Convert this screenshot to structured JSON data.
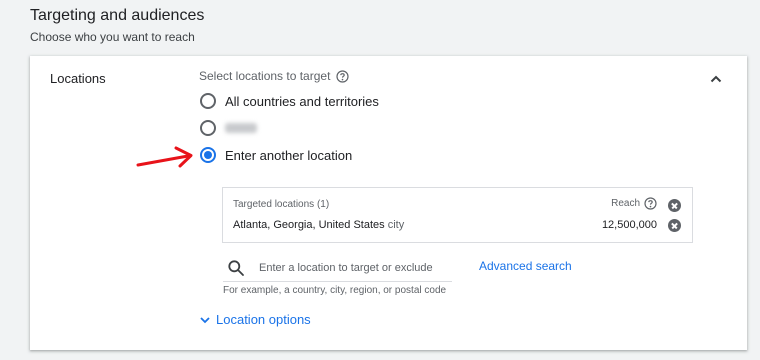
{
  "header": {
    "title": "Targeting and audiences",
    "subtitle": "Choose who you want to reach"
  },
  "card": {
    "label": "Locations",
    "select_label": "Select locations to target",
    "options": [
      {
        "label": "All countries and territories",
        "checked": false
      },
      {
        "label": "",
        "checked": false,
        "blurred": true
      },
      {
        "label": "Enter another location",
        "checked": true
      }
    ],
    "targeted": {
      "header": "Targeted locations (1)",
      "reach_label": "Reach",
      "location": "Atlanta, Georgia, United States",
      "location_type": "city",
      "reach_value": "12,500,000"
    },
    "search": {
      "placeholder": "Enter a location to target or exclude",
      "hint": "For example, a country, city, region, or postal code",
      "advanced_label": "Advanced search"
    },
    "location_options_label": "Location options"
  },
  "colors": {
    "accent": "#1a73e8",
    "annotation_arrow": "#e8131a"
  },
  "icons": [
    "help-icon",
    "chevron-up-icon",
    "close-icon",
    "search-icon",
    "chevron-down-icon",
    "arrow-annotation"
  ]
}
